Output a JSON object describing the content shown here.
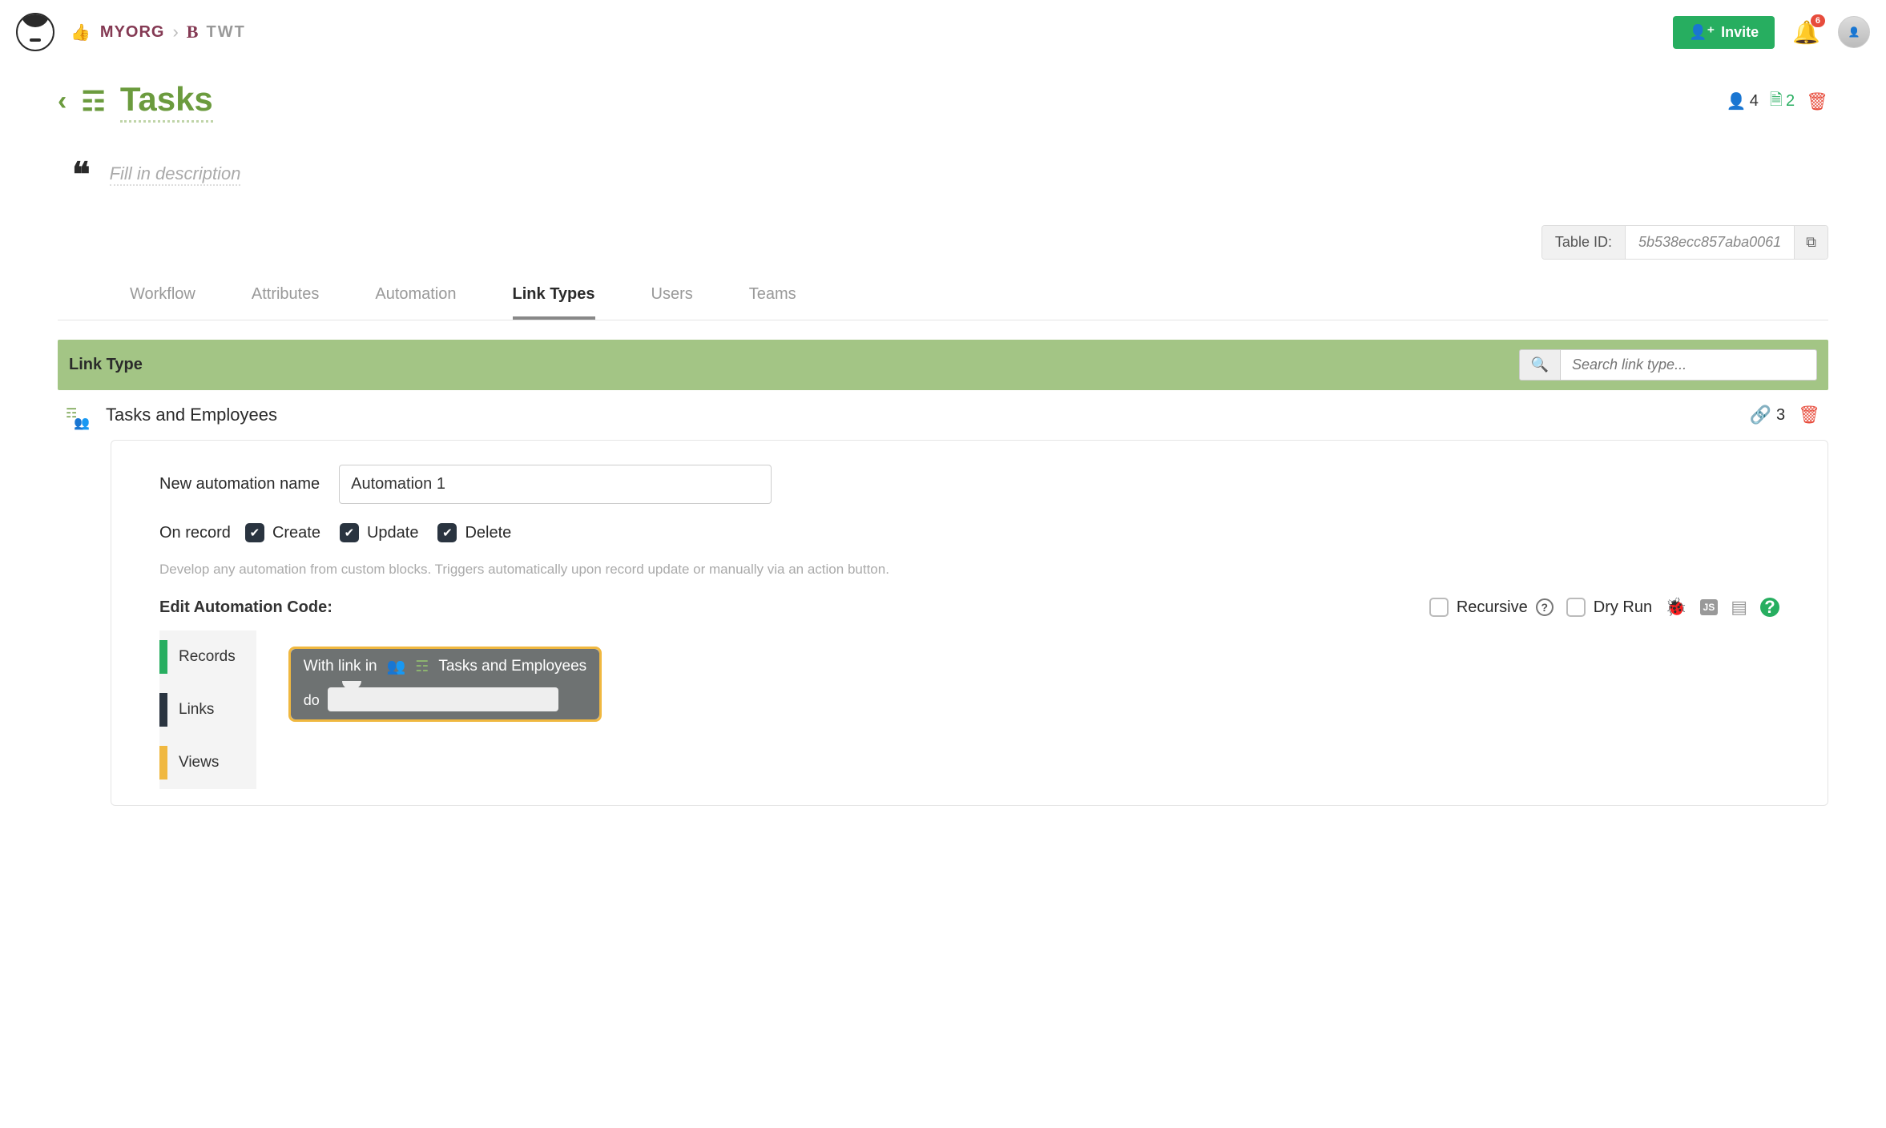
{
  "header": {
    "org": "MYORG",
    "project_letter": "B",
    "project": "TWT",
    "invite_label": "Invite",
    "notification_count": "6"
  },
  "page": {
    "title": "Tasks",
    "description_placeholder": "Fill in description",
    "users_count": "4",
    "docs_count": "2",
    "table_id_label": "Table ID:",
    "table_id_value": "5b538ecc857aba0061"
  },
  "tabs": {
    "workflow": "Workflow",
    "attributes": "Attributes",
    "automation": "Automation",
    "link_types": "Link Types",
    "users": "Users",
    "teams": "Teams"
  },
  "linktype_bar": {
    "label": "Link Type",
    "search_placeholder": "Search link type..."
  },
  "link_type": {
    "name": "Tasks and Employees",
    "count": "3"
  },
  "form": {
    "name_label": "New automation name",
    "name_value": "Automation 1",
    "on_record_label": "On record",
    "create": "Create",
    "update": "Update",
    "delete": "Delete",
    "helper": "Develop any automation from custom blocks. Triggers automatically upon record update or manually via an action button.",
    "edit_label": "Edit Automation Code:",
    "recursive": "Recursive",
    "dry_run": "Dry Run"
  },
  "block_cats": {
    "records": "Records",
    "links": "Links",
    "views": "Views"
  },
  "block": {
    "with_link": "With link in",
    "target": "Tasks and Employees",
    "do": "do"
  }
}
